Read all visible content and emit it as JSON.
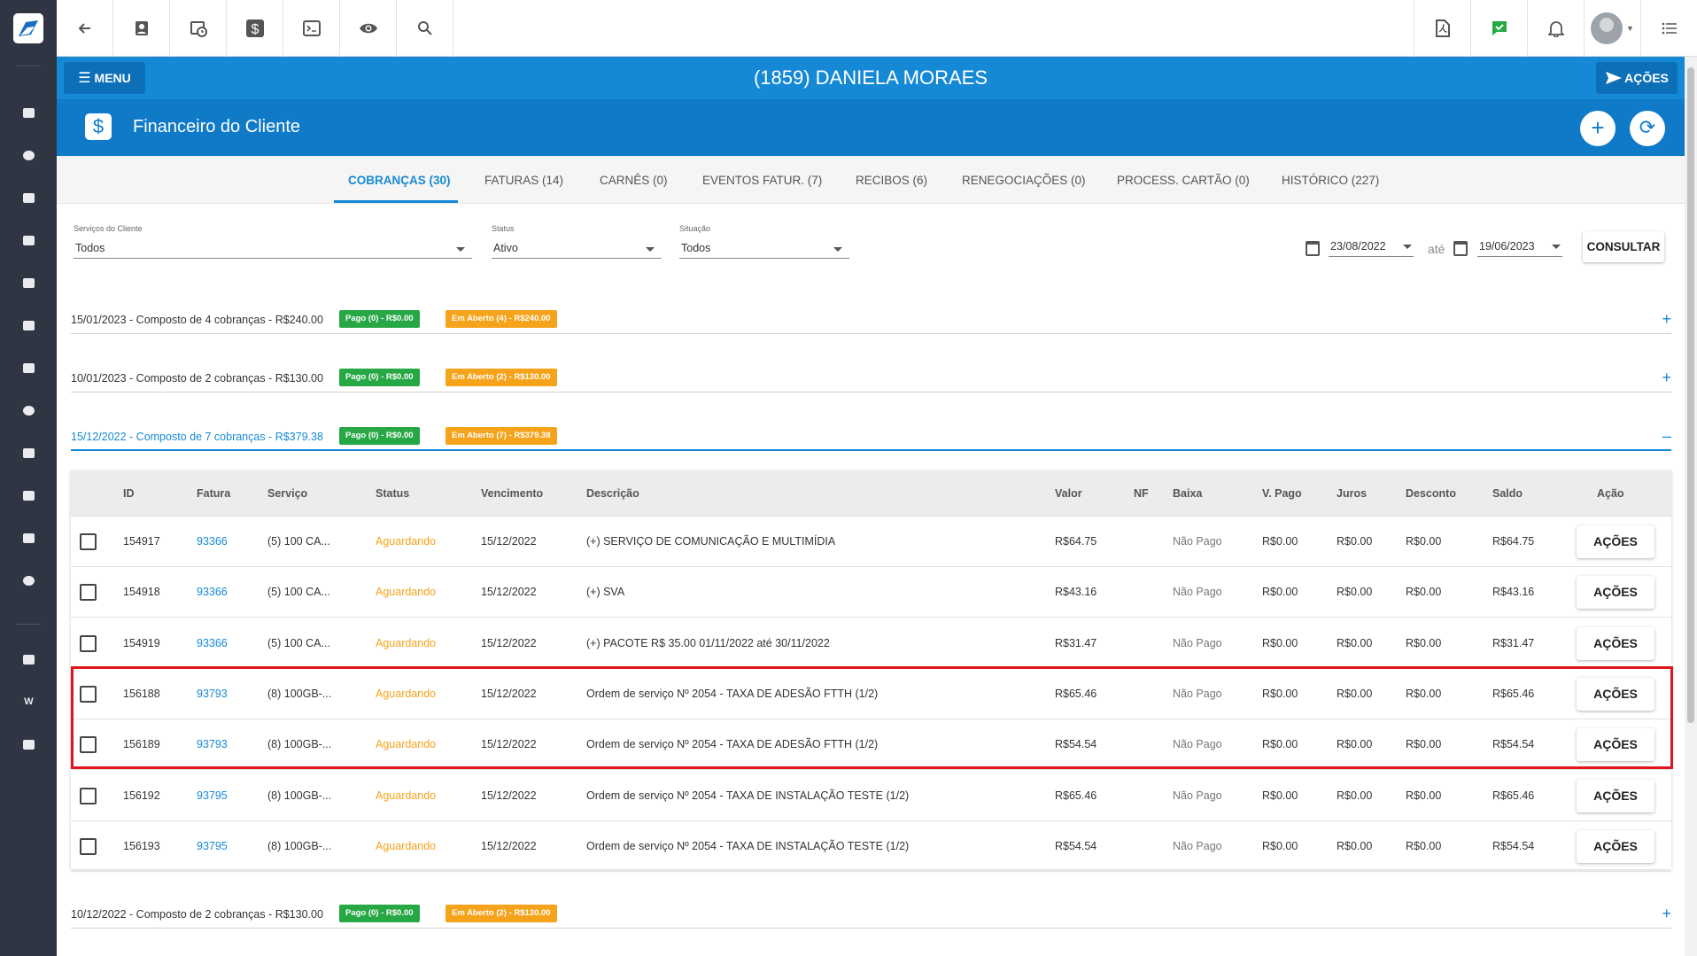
{
  "header": {
    "menu_label": "MENU",
    "client_title": "(1859) DANIELA MORAES",
    "actions_label": "AÇÕES"
  },
  "section": {
    "title": "Financeiro do Cliente",
    "icon": "dollar-icon"
  },
  "tabs": [
    {
      "label": "COBRANÇAS (30)"
    },
    {
      "label": "FATURAS (14)"
    },
    {
      "label": "CARNÊS (0)"
    },
    {
      "label": "EVENTOS FATUR. (7)"
    },
    {
      "label": "RECIBOS (6)"
    },
    {
      "label": "RENEGOCIAÇÕES (0)"
    },
    {
      "label": "PROCESS. CARTÃO (0)"
    },
    {
      "label": "HISTÓRICO (227)"
    }
  ],
  "filters": {
    "servicos_label": "Serviços do Cliente",
    "servicos_value": "Todos",
    "status_label": "Status",
    "status_value": "Ativo",
    "situacao_label": "Situação",
    "situacao_value": "Todos",
    "date_from": "23/08/2022",
    "ate_label": "até",
    "date_to": "19/06/2023",
    "consultar_label": "CONSULTAR"
  },
  "groups": [
    {
      "title": "15/01/2023 - Composto de 4 cobranças - R$240.00",
      "paid": "Pago (0) - R$0.00",
      "open": "Em Aberto (4) - R$240.00",
      "toggle": "+"
    },
    {
      "title": "10/01/2023 - Composto de 2 cobranças - R$130.00",
      "paid": "Pago (0) - R$0.00",
      "open": "Em Aberto (2) - R$130.00",
      "toggle": "+"
    },
    {
      "title": "15/12/2022 - Composto de 7 cobranças - R$379.38",
      "paid": "Pago (0) - R$0.00",
      "open": "Em Aberto (7) - R$379.38",
      "toggle": "–"
    },
    {
      "title": "10/12/2022 - Composto de 2 cobranças - R$130.00",
      "paid": "Pago (0) - R$0.00",
      "open": "Em Aberto (2) - R$130.00",
      "toggle": "+"
    }
  ],
  "table": {
    "headers": [
      "ID",
      "Fatura",
      "Serviço",
      "Status",
      "Vencimento",
      "Descrição",
      "Valor",
      "NF",
      "Baixa",
      "V. Pago",
      "Juros",
      "Desconto",
      "Saldo",
      "Ação"
    ],
    "action_label": "AÇÕES",
    "rows": [
      {
        "id": "154917",
        "fatura": "93366",
        "servico": "(5) 100 CA...",
        "status": "Aguardando",
        "venc": "15/12/2022",
        "desc": "(+) SERVIÇO DE COMUNICAÇÃO E MULTIMÍDIA",
        "valor": "R$64.75",
        "baixa": "Não Pago",
        "vpago": "R$0.00",
        "juros": "R$0.00",
        "desconto": "R$0.00",
        "saldo": "R$64.75"
      },
      {
        "id": "154918",
        "fatura": "93366",
        "servico": "(5) 100 CA...",
        "status": "Aguardando",
        "venc": "15/12/2022",
        "desc": "(+) SVA",
        "valor": "R$43.16",
        "baixa": "Não Pago",
        "vpago": "R$0.00",
        "juros": "R$0.00",
        "desconto": "R$0.00",
        "saldo": "R$43.16"
      },
      {
        "id": "154919",
        "fatura": "93366",
        "servico": "(5) 100 CA...",
        "status": "Aguardando",
        "venc": "15/12/2022",
        "desc": "(+) PACOTE R$ 35.00 01/11/2022 até 30/11/2022",
        "valor": "R$31.47",
        "baixa": "Não Pago",
        "vpago": "R$0.00",
        "juros": "R$0.00",
        "desconto": "R$0.00",
        "saldo": "R$31.47"
      },
      {
        "id": "156188",
        "fatura": "93793",
        "servico": "(8) 100GB-...",
        "status": "Aguardando",
        "venc": "15/12/2022",
        "desc": "Ordem de serviço Nº 2054 - TAXA DE ADESÃO FTTH (1/2)",
        "valor": "R$65.46",
        "baixa": "Não Pago",
        "vpago": "R$0.00",
        "juros": "R$0.00",
        "desconto": "R$0.00",
        "saldo": "R$65.46"
      },
      {
        "id": "156189",
        "fatura": "93793",
        "servico": "(8) 100GB-...",
        "status": "Aguardando",
        "venc": "15/12/2022",
        "desc": "Ordem de serviço Nº 2054 - TAXA DE ADESÃO FTTH (1/2)",
        "valor": "R$54.54",
        "baixa": "Não Pago",
        "vpago": "R$0.00",
        "juros": "R$0.00",
        "desconto": "R$0.00",
        "saldo": "R$54.54"
      },
      {
        "id": "156192",
        "fatura": "93795",
        "servico": "(8) 100GB-...",
        "status": "Aguardando",
        "venc": "15/12/2022",
        "desc": "Ordem de serviço Nº 2054 - TAXA DE INSTALAÇÃO TESTE (1/2)",
        "valor": "R$65.46",
        "baixa": "Não Pago",
        "vpago": "R$0.00",
        "juros": "R$0.00",
        "desconto": "R$0.00",
        "saldo": "R$65.46"
      },
      {
        "id": "156193",
        "fatura": "93795",
        "servico": "(8) 100GB-...",
        "status": "Aguardando",
        "venc": "15/12/2022",
        "desc": "Ordem de serviço Nº 2054 - TAXA DE INSTALAÇÃO TESTE (1/2)",
        "valor": "R$54.54",
        "baixa": "Não Pago",
        "vpago": "R$0.00",
        "juros": "R$0.00",
        "desconto": "R$0.00",
        "saldo": "R$54.54"
      }
    ]
  },
  "colors": {
    "primary": "#1689d6",
    "header_dark": "#0f7ac8",
    "sidebar": "#2f3542",
    "paid_badge": "#27a845",
    "open_badge": "#f5a31a",
    "highlight": "#e0141d"
  }
}
